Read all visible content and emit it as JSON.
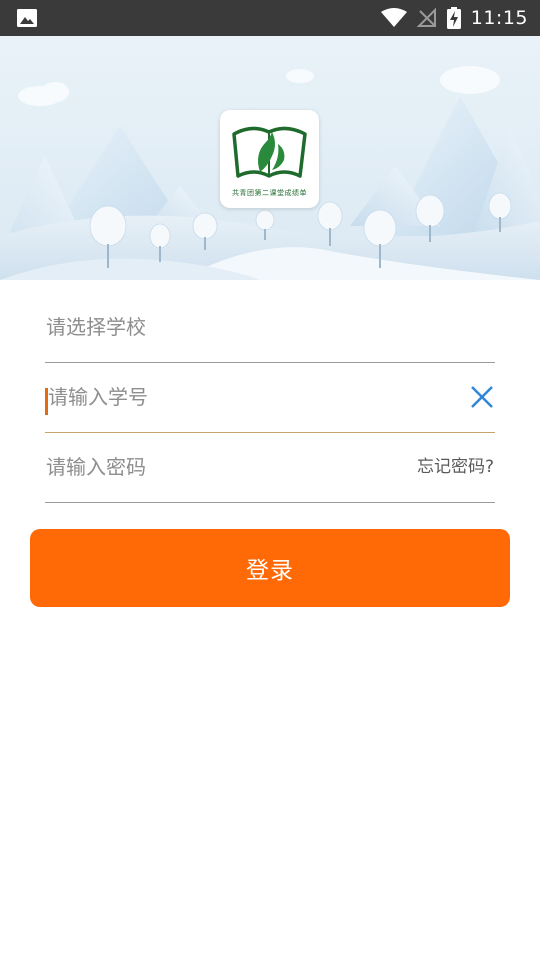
{
  "status_bar": {
    "time": "11:15",
    "icons": [
      "image-icon",
      "wifi-icon",
      "signal-off-icon",
      "battery-charging-icon"
    ]
  },
  "banner": {
    "logo_caption": "共青团第二课堂成绩单"
  },
  "form": {
    "school_placeholder": "请选择学校",
    "student_id_placeholder": "请输入学号",
    "password_placeholder": "请输入密码",
    "forgot_password": "忘记密码?",
    "login_label": "登录"
  },
  "colors": {
    "accent": "#ff6a06",
    "clear_icon": "#2f86d6",
    "status_bar": "#3a3a3a",
    "logo_green": "#1f6b2e"
  }
}
